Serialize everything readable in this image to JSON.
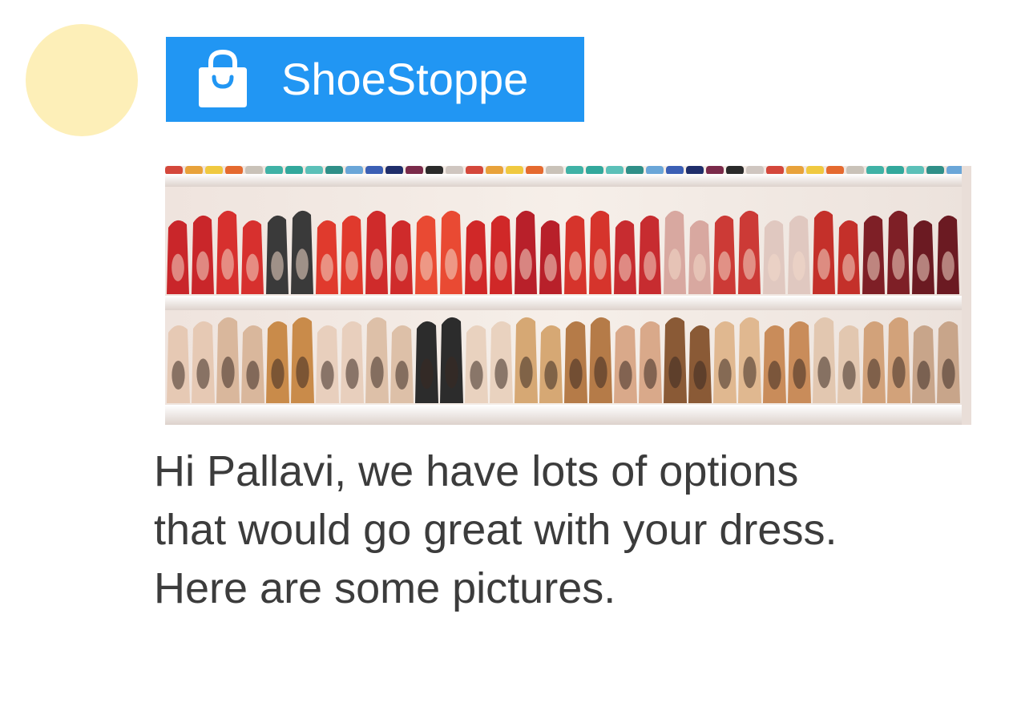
{
  "colors": {
    "avatar": "#FDEFB8",
    "brand_chip": "#2196F3",
    "text": "#3c3c3c"
  },
  "sender": {
    "avatar_icon": "avatar-placeholder",
    "name": "ShoeStoppe",
    "icon": "shopping-bag-icon"
  },
  "message": {
    "image": "shoe-shelves-photo",
    "lines": [
      "Hi Pallavi, we have lots of options",
      "that would go great with your dress.",
      "Here are some pictures."
    ]
  }
}
